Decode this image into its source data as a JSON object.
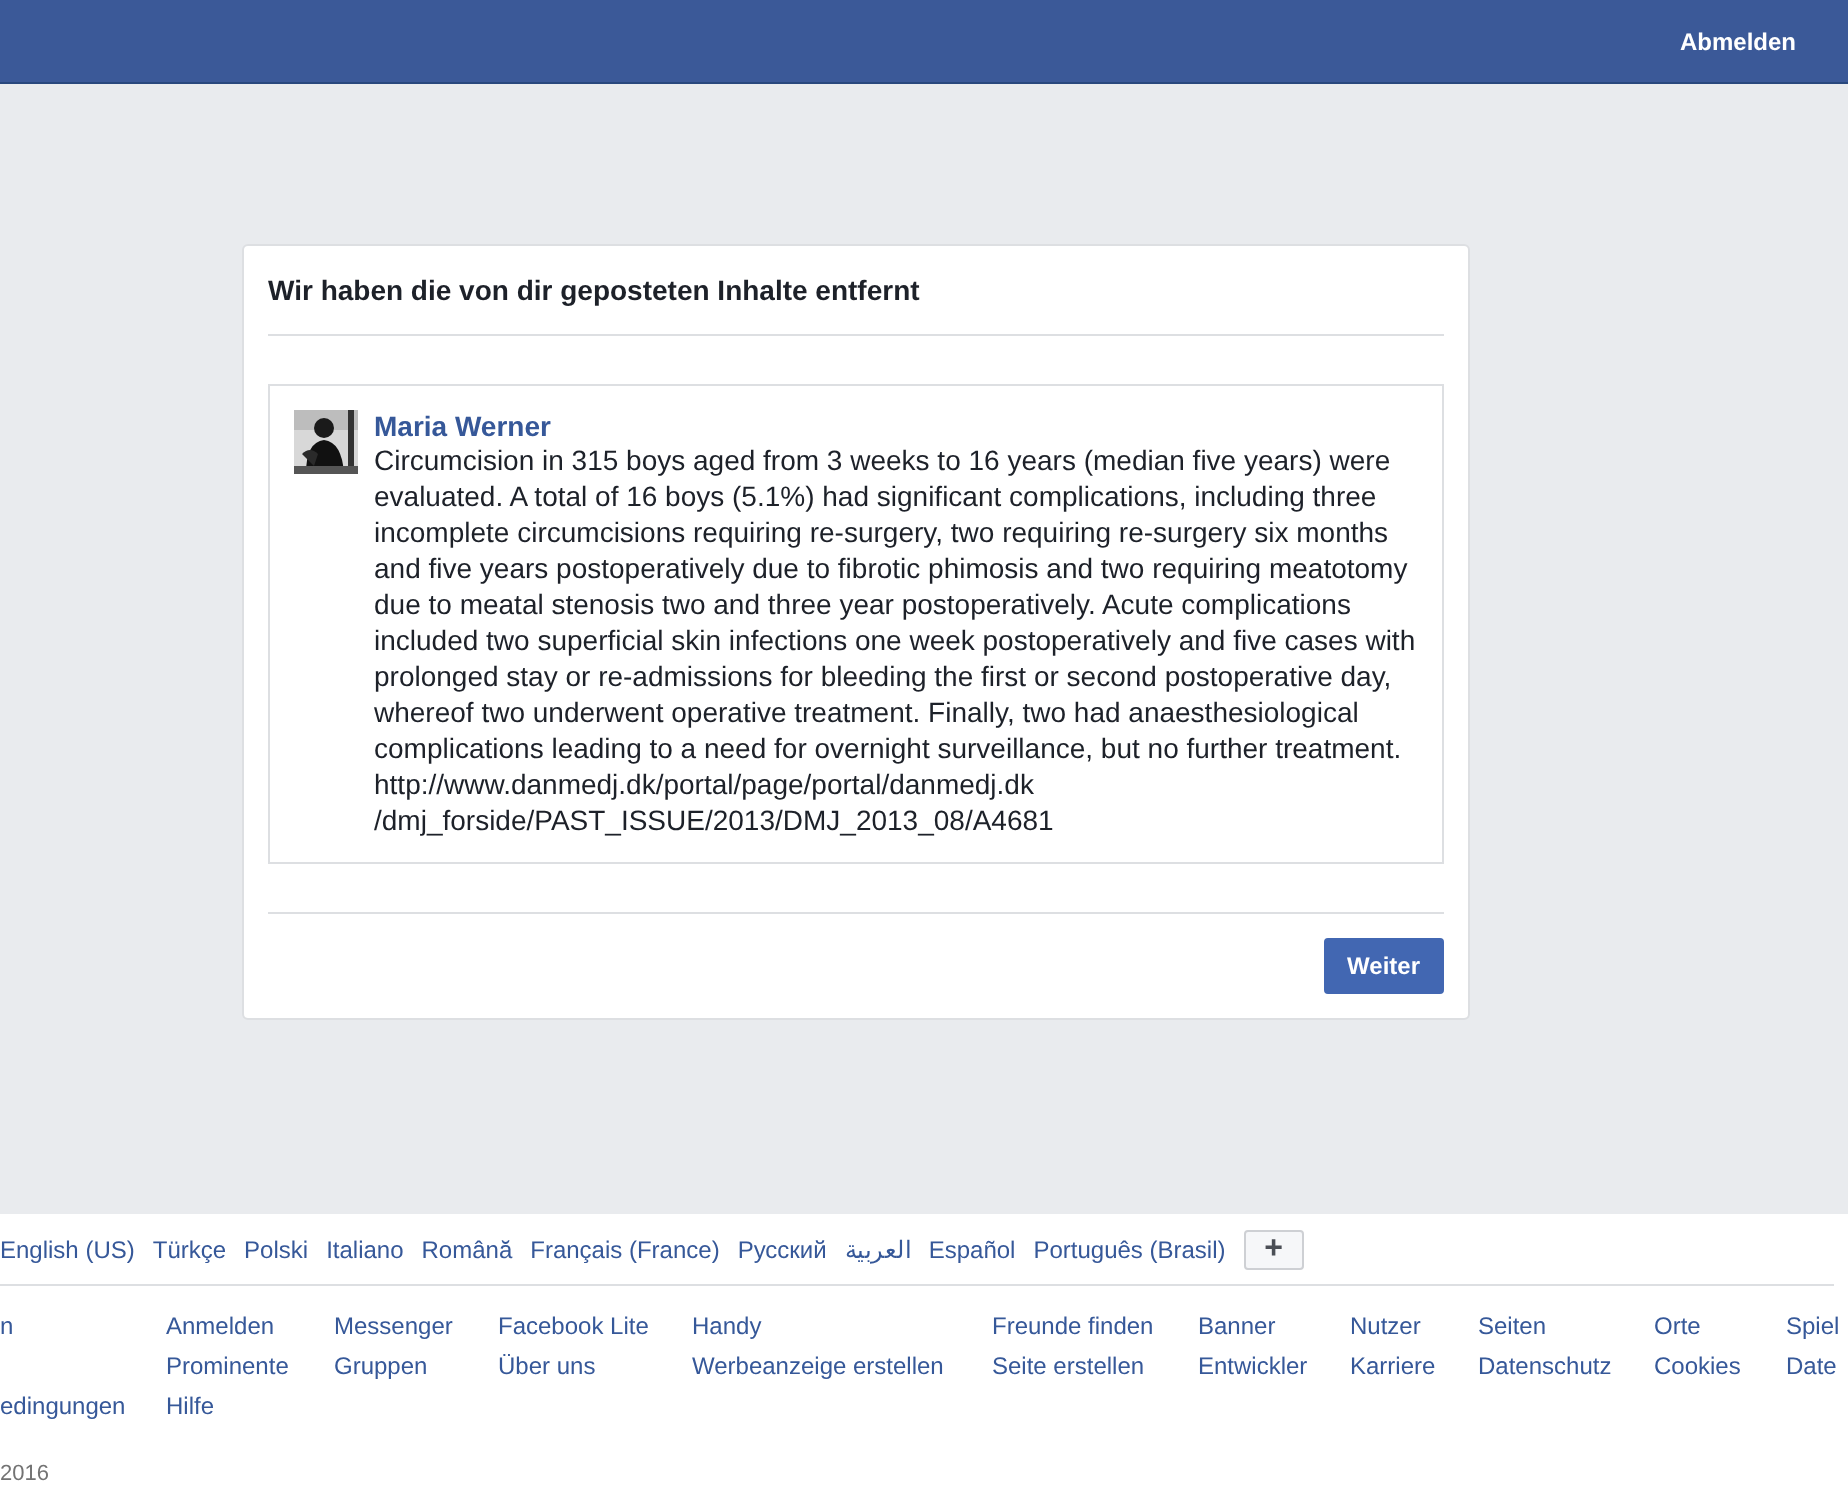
{
  "header": {
    "logout": "Abmelden"
  },
  "dialog": {
    "title": "Wir haben die von dir geposteten Inhalte entfernt",
    "post": {
      "author": "Maria Werner",
      "text": "Circumcision in 315 boys aged from 3 weeks to 16 years (median five years) were evaluated. A total of 16 boys (5.1%) had significant complications, including three incomplete circumcisions requiring re-surgery, two requiring re-surgery six months and five years postoperatively due to fibrotic phimosis and two requiring meatotomy due to meatal stenosis two and three year postoperatively. Acute complications included two superficial skin infections one week postoperatively and five cases with prolonged stay or re-admissions for bleeding the first or second postoperative day, whereof two underwent operative treatment. Finally, two had anaesthesiological complications leading to a need for overnight surveillance, but no further treatment. http://www.danmedj.dk/portal/page/portal/danmedj.dk /dmj_forside/PAST_ISSUE/2013/DMJ_2013_08/A4681"
    },
    "button": "Weiter"
  },
  "footer": {
    "languages": [
      "English (US)",
      "Türkçe",
      "Polski",
      "Italiano",
      "Română",
      "Français (France)",
      "Русский",
      "العربية",
      "Español",
      "Português (Brasil)"
    ],
    "more_button": "+",
    "cut_column": {
      "top": "n",
      "bottom": "edingungen"
    },
    "link_columns": [
      [
        "Anmelden",
        "Prominente",
        "Hilfe"
      ],
      [
        "Messenger",
        "Gruppen"
      ],
      [
        "Facebook Lite",
        "Über uns"
      ],
      [
        "Handy",
        "Werbeanzeige erstellen"
      ],
      [
        "Freunde finden",
        "Seite erstellen"
      ],
      [
        "Banner",
        "Entwickler"
      ],
      [
        "Nutzer",
        "Karriere"
      ],
      [
        "Seiten",
        "Datenschutz"
      ],
      [
        "Orte",
        "Cookies"
      ],
      [
        "Spiel",
        "Date"
      ]
    ],
    "copyright": "2016"
  }
}
